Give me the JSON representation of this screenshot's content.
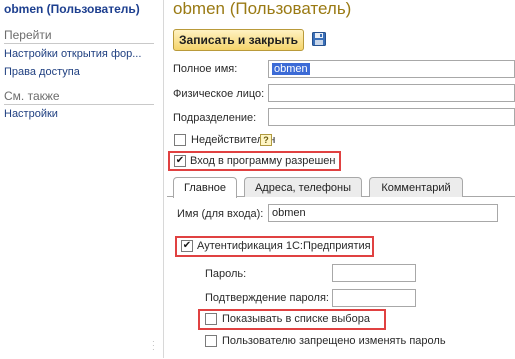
{
  "left": {
    "title": "obmen (Пользователь)",
    "goto_header": "Перейти",
    "goto_items": [
      "Настройки открытия фор...",
      "Права доступа"
    ],
    "see_also_header": "См. также",
    "see_also_items": [
      "Настройки"
    ]
  },
  "main": {
    "title": "obmen (Пользователь)",
    "save_close_label": "Записать и закрыть",
    "fields": {
      "full_name_label": "Полное имя:",
      "full_name_value": "obmen",
      "person_label": "Физическое лицо:",
      "person_value": "",
      "department_label": "Подразделение:",
      "department_value": ""
    },
    "invalid_label": "Недействителен",
    "invalid_checked": false,
    "help_glyph": "?",
    "login_allowed_label": "Вход в программу разрешен",
    "login_allowed_checked": true
  },
  "tabs": [
    "Главное",
    "Адреса, телефоны",
    "Комментарий"
  ],
  "tab_main": {
    "login_name_label": "Имя (для входа):",
    "login_name_value": "obmen",
    "auth_label": "Аутентификация 1С:Предприятия",
    "auth_checked": true,
    "password_label": "Пароль:",
    "password_value": "",
    "password_confirm_label": "Подтверждение пароля:",
    "password_confirm_value": "",
    "show_in_list_label": "Показывать в списке выбора",
    "show_in_list_checked": false,
    "no_change_password_label": "Пользователю запрещено изменять пароль",
    "no_change_password_checked": false
  },
  "colors": {
    "title": "#9a7a13",
    "highlight": "#e04141",
    "link": "#1f3f80",
    "selection": "#3c6bd6"
  }
}
